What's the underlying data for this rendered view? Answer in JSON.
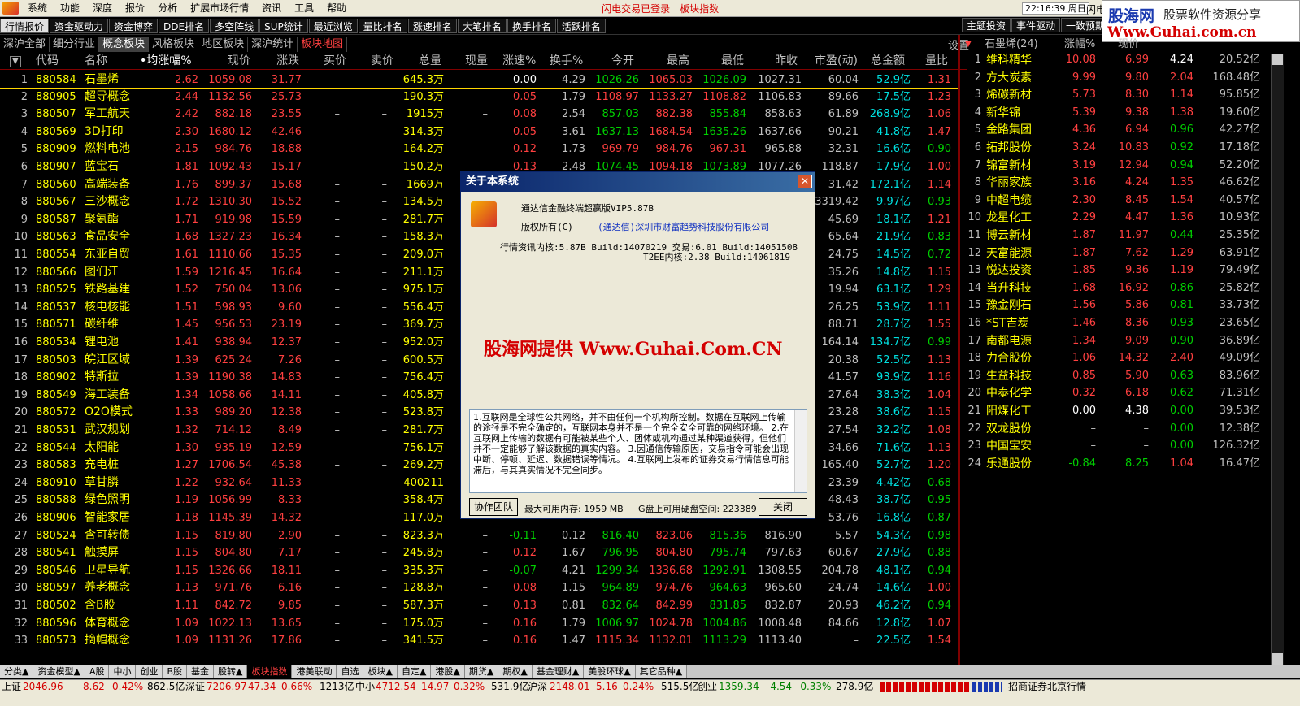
{
  "menubar": {
    "items": [
      "系统",
      "功能",
      "深度",
      "报价",
      "分析",
      "扩展市场行情",
      "资讯",
      "工具",
      "帮助"
    ],
    "alert1": "闪电交易已登录",
    "alert2": "板块指数",
    "time": "22:16:39 周日",
    "flash": "闪电手"
  },
  "banner": {
    "line1": "股海网",
    "line1b": "股票软件资源分享",
    "line2": "Www.Guhai.com.cn"
  },
  "tabs1": [
    "行情报价",
    "资金驱动力",
    "资金博弈",
    "DDE排名",
    "多空阵线",
    "SUP统计",
    "最近浏览",
    "量比排名",
    "涨速排名",
    "大笔排名",
    "换手排名",
    "活跃排名"
  ],
  "tabs1_right": [
    "主题投资",
    "事件驱动",
    "一致预期",
    "板"
  ],
  "tabs2": [
    "深沪全部",
    "细分行业",
    "概念板块",
    "风格板块",
    "地区板块",
    "深沪统计",
    "板块地图"
  ],
  "settings": "设置",
  "main_header": {
    "code": "代码",
    "name": "名称",
    "chg": "•均涨幅%",
    "price": "现价",
    "up": "涨跌",
    "buy": "买价",
    "sell": "卖价",
    "vol": "总量",
    "cur": "现量",
    "spd": "涨速%",
    "turn": "换手%",
    "open": "今开",
    "high": "最高",
    "low": "最低",
    "prev": "昨收",
    "pe": "市盈(动)",
    "amt": "总金额",
    "ratio": "量比"
  },
  "rows": [
    [
      "1",
      "880584",
      "石墨烯",
      "2.62",
      "1059.08",
      "31.77",
      "–",
      "–",
      "645.3万",
      "–",
      "0.00",
      "4.29",
      "1026.26",
      "1065.03",
      "1026.09",
      "1027.31",
      "60.04",
      "52.9亿",
      "1.31"
    ],
    [
      "2",
      "880905",
      "超导概念",
      "2.44",
      "1132.56",
      "25.73",
      "–",
      "–",
      "190.3万",
      "–",
      "0.05",
      "1.79",
      "1108.97",
      "1133.27",
      "1108.82",
      "1106.83",
      "89.66",
      "17.5亿",
      "1.23"
    ],
    [
      "3",
      "880507",
      "军工航天",
      "2.42",
      "882.18",
      "23.55",
      "–",
      "–",
      "1915万",
      "–",
      "0.08",
      "2.54",
      "857.03",
      "882.38",
      "855.84",
      "858.63",
      "61.89",
      "268.9亿",
      "1.06"
    ],
    [
      "4",
      "880569",
      "3D打印",
      "2.30",
      "1680.12",
      "42.46",
      "–",
      "–",
      "314.3万",
      "–",
      "0.05",
      "3.61",
      "1637.13",
      "1684.54",
      "1635.26",
      "1637.66",
      "90.21",
      "41.8亿",
      "1.47"
    ],
    [
      "5",
      "880909",
      "燃料电池",
      "2.15",
      "984.76",
      "18.88",
      "–",
      "–",
      "164.2万",
      "–",
      "0.12",
      "1.73",
      "969.79",
      "984.76",
      "967.31",
      "965.88",
      "32.31",
      "16.6亿",
      "0.90"
    ],
    [
      "6",
      "880907",
      "蓝宝石",
      "1.81",
      "1092.43",
      "15.17",
      "–",
      "–",
      "150.2万",
      "–",
      "0.13",
      "2.48",
      "1074.45",
      "1094.18",
      "1073.89",
      "1077.26",
      "118.87",
      "17.9亿",
      "1.00"
    ],
    [
      "7",
      "880560",
      "高端装备",
      "1.76",
      "899.37",
      "15.68",
      "–",
      "–",
      "1669万",
      "–",
      "",
      "",
      "",
      "",
      "",
      "",
      "31.42",
      "172.1亿",
      "1.14"
    ],
    [
      "8",
      "880567",
      "三沙概念",
      "1.72",
      "1310.30",
      "15.52",
      "–",
      "–",
      "134.5万",
      "–",
      "",
      "",
      "",
      "",
      "",
      "",
      "3319.42",
      "9.97亿",
      "0.93"
    ],
    [
      "9",
      "880587",
      "聚氨酯",
      "1.71",
      "919.98",
      "15.59",
      "–",
      "–",
      "281.7万",
      "–",
      "",
      "",
      "",
      "",
      "",
      "",
      "45.69",
      "18.1亿",
      "1.21"
    ],
    [
      "10",
      "880563",
      "食品安全",
      "1.68",
      "1327.23",
      "16.34",
      "–",
      "–",
      "158.3万",
      "–",
      "",
      "",
      "",
      "",
      "",
      "",
      "65.64",
      "21.9亿",
      "0.83"
    ],
    [
      "11",
      "880554",
      "东亚自贸",
      "1.61",
      "1110.66",
      "15.35",
      "–",
      "–",
      "209.0万",
      "–",
      "",
      "",
      "",
      "",
      "",
      "",
      "24.75",
      "14.5亿",
      "0.72"
    ],
    [
      "12",
      "880566",
      "图们江",
      "1.59",
      "1216.45",
      "16.64",
      "–",
      "–",
      "211.1万",
      "–",
      "",
      "",
      "",
      "",
      "",
      "",
      "35.26",
      "14.8亿",
      "1.15"
    ],
    [
      "13",
      "880525",
      "铁路基建",
      "1.52",
      "750.04",
      "13.06",
      "–",
      "–",
      "975.1万",
      "–",
      "",
      "",
      "",
      "",
      "",
      "",
      "19.94",
      "63.1亿",
      "1.29"
    ],
    [
      "14",
      "880537",
      "核电核能",
      "1.51",
      "598.93",
      "9.60",
      "–",
      "–",
      "556.4万",
      "–",
      "",
      "",
      "",
      "",
      "",
      "",
      "26.25",
      "53.9亿",
      "1.11"
    ],
    [
      "15",
      "880571",
      "碳纤维",
      "1.45",
      "956.53",
      "23.19",
      "–",
      "–",
      "369.7万",
      "–",
      "",
      "",
      "",
      "",
      "",
      "",
      "88.71",
      "28.7亿",
      "1.55"
    ],
    [
      "16",
      "880534",
      "锂电池",
      "1.41",
      "938.94",
      "12.37",
      "–",
      "–",
      "952.0万",
      "–",
      "",
      "",
      "",
      "",
      "",
      "",
      "164.14",
      "134.7亿",
      "0.99"
    ],
    [
      "17",
      "880503",
      "皖江区域",
      "1.39",
      "625.24",
      "7.26",
      "–",
      "–",
      "600.5万",
      "–",
      "",
      "",
      "",
      "",
      "",
      "",
      "20.38",
      "52.5亿",
      "1.13"
    ],
    [
      "18",
      "880902",
      "特斯拉",
      "1.39",
      "1190.38",
      "14.83",
      "–",
      "–",
      "756.4万",
      "–",
      "",
      "",
      "",
      "",
      "",
      "",
      "41.57",
      "93.9亿",
      "1.16"
    ],
    [
      "19",
      "880549",
      "海工装备",
      "1.34",
      "1058.66",
      "14.11",
      "–",
      "–",
      "405.8万",
      "–",
      "",
      "",
      "",
      "",
      "",
      "",
      "27.64",
      "38.3亿",
      "1.04"
    ],
    [
      "20",
      "880572",
      "O2O模式",
      "1.33",
      "989.20",
      "12.38",
      "–",
      "–",
      "523.8万",
      "–",
      "",
      "",
      "",
      "",
      "",
      "",
      "23.28",
      "38.6亿",
      "1.15"
    ],
    [
      "21",
      "880531",
      "武汉规划",
      "1.32",
      "714.12",
      "8.49",
      "–",
      "–",
      "281.7万",
      "–",
      "",
      "",
      "",
      "",
      "",
      "",
      "27.54",
      "32.2亿",
      "1.08"
    ],
    [
      "22",
      "880544",
      "太阳能",
      "1.30",
      "935.19",
      "12.59",
      "–",
      "–",
      "756.1万",
      "–",
      "",
      "",
      "",
      "",
      "",
      "",
      "34.66",
      "71.6亿",
      "1.13"
    ],
    [
      "23",
      "880583",
      "充电桩",
      "1.27",
      "1706.54",
      "45.38",
      "–",
      "–",
      "269.2万",
      "–",
      "",
      "",
      "",
      "",
      "",
      "",
      "165.40",
      "52.7亿",
      "1.20"
    ],
    [
      "24",
      "880910",
      "草甘膦",
      "1.22",
      "932.64",
      "11.33",
      "–",
      "–",
      "400211",
      "–",
      "",
      "",
      "",
      "",
      "",
      "",
      "23.39",
      "4.42亿",
      "0.68"
    ],
    [
      "25",
      "880588",
      "绿色照明",
      "1.19",
      "1056.99",
      "8.33",
      "–",
      "–",
      "358.4万",
      "–",
      "",
      "",
      "",
      "",
      "",
      "",
      "48.43",
      "38.7亿",
      "0.95"
    ],
    [
      "26",
      "880906",
      "智能家居",
      "1.18",
      "1145.39",
      "14.32",
      "–",
      "–",
      "117.0万",
      "–",
      "",
      "",
      "",
      "",
      "",
      "",
      "53.76",
      "16.8亿",
      "0.87"
    ],
    [
      "27",
      "880524",
      "含可转债",
      "1.15",
      "819.80",
      "2.90",
      "–",
      "–",
      "823.3万",
      "–",
      "-0.11",
      "0.12",
      "816.40",
      "823.06",
      "815.36",
      "816.90",
      "5.57",
      "54.3亿",
      "0.98"
    ],
    [
      "28",
      "880541",
      "触摸屏",
      "1.15",
      "804.80",
      "7.17",
      "–",
      "–",
      "245.8万",
      "–",
      "0.12",
      "1.67",
      "796.95",
      "804.80",
      "795.74",
      "797.63",
      "60.67",
      "27.9亿",
      "0.88"
    ],
    [
      "29",
      "880546",
      "卫星导航",
      "1.15",
      "1326.66",
      "18.11",
      "–",
      "–",
      "335.3万",
      "–",
      "-0.07",
      "4.21",
      "1299.34",
      "1336.68",
      "1292.91",
      "1308.55",
      "204.78",
      "48.1亿",
      "0.94"
    ],
    [
      "30",
      "880597",
      "养老概念",
      "1.13",
      "971.76",
      "6.16",
      "–",
      "–",
      "128.8万",
      "–",
      "0.08",
      "1.15",
      "964.89",
      "974.76",
      "964.63",
      "965.60",
      "24.74",
      "14.6亿",
      "1.00"
    ],
    [
      "31",
      "880502",
      "含B股",
      "1.11",
      "842.72",
      "9.85",
      "–",
      "–",
      "587.3万",
      "–",
      "0.13",
      "0.81",
      "832.64",
      "842.99",
      "831.85",
      "832.87",
      "20.93",
      "46.2亿",
      "0.94"
    ],
    [
      "32",
      "880596",
      "体育概念",
      "1.09",
      "1022.13",
      "13.65",
      "–",
      "–",
      "175.0万",
      "–",
      "0.16",
      "1.79",
      "1006.97",
      "1024.78",
      "1004.86",
      "1008.48",
      "84.66",
      "12.8亿",
      "1.07"
    ],
    [
      "33",
      "880573",
      "摘帽概念",
      "1.09",
      "1131.26",
      "17.86",
      "–",
      "–",
      "341.5万",
      "–",
      "0.16",
      "1.47",
      "1115.34",
      "1132.01",
      "1113.29",
      "1113.40",
      "–",
      "22.5亿",
      "1.54"
    ]
  ],
  "right_header": {
    "mark": "▼",
    "block": "石墨烯(24)",
    "chg": "涨幅%",
    "price": "现价"
  },
  "right_rows": [
    [
      "1",
      "维科精华",
      "10.08",
      "6.99",
      "4.24",
      "20.52亿"
    ],
    [
      "2",
      "方大炭素",
      "9.99",
      "9.80",
      "2.04",
      "168.48亿"
    ],
    [
      "3",
      "烯碳新材",
      "5.73",
      "8.30",
      "1.14",
      "95.85亿"
    ],
    [
      "4",
      "新华锦",
      "5.39",
      "9.38",
      "1.38",
      "19.60亿"
    ],
    [
      "5",
      "金路集团",
      "4.36",
      "6.94",
      "0.96",
      "42.27亿"
    ],
    [
      "6",
      "拓邦股份",
      "3.24",
      "10.83",
      "0.92",
      "17.18亿"
    ],
    [
      "7",
      "锦富新材",
      "3.19",
      "12.94",
      "0.94",
      "52.20亿"
    ],
    [
      "8",
      "华丽家族",
      "3.16",
      "4.24",
      "1.35",
      "46.62亿"
    ],
    [
      "9",
      "中超电缆",
      "2.30",
      "8.45",
      "1.54",
      "40.57亿"
    ],
    [
      "10",
      "龙星化工",
      "2.29",
      "4.47",
      "1.36",
      "10.93亿"
    ],
    [
      "11",
      "博云新材",
      "1.87",
      "11.97",
      "0.44",
      "25.35亿"
    ],
    [
      "12",
      "天富能源",
      "1.87",
      "7.62",
      "1.29",
      "63.91亿"
    ],
    [
      "13",
      "悦达投资",
      "1.85",
      "9.36",
      "1.19",
      "79.49亿"
    ],
    [
      "14",
      "当升科技",
      "1.68",
      "16.92",
      "0.86",
      "25.82亿"
    ],
    [
      "15",
      "豫金刚石",
      "1.56",
      "5.86",
      "0.81",
      "33.73亿"
    ],
    [
      "16",
      "*ST吉炭",
      "1.46",
      "8.36",
      "0.93",
      "23.65亿"
    ],
    [
      "17",
      "南都电源",
      "1.34",
      "9.09",
      "0.90",
      "36.89亿"
    ],
    [
      "18",
      "力合股份",
      "1.06",
      "14.32",
      "2.40",
      "49.09亿"
    ],
    [
      "19",
      "生益科技",
      "0.85",
      "5.90",
      "0.63",
      "83.96亿"
    ],
    [
      "20",
      "中泰化学",
      "0.32",
      "6.18",
      "0.62",
      "71.31亿"
    ],
    [
      "21",
      "阳煤化工",
      "0.00",
      "4.38",
      "0.00",
      "39.53亿"
    ],
    [
      "22",
      "双龙股份",
      "–",
      "–",
      "0.00",
      "12.38亿"
    ],
    [
      "23",
      "中国宝安",
      "–",
      "–",
      "0.00",
      "126.32亿"
    ],
    [
      "24",
      "乐通股份",
      "-0.84",
      "8.25",
      "1.04",
      "16.47亿"
    ]
  ],
  "bottom_tabs": [
    "分类▲",
    "资金模型▲",
    "A股",
    "中小",
    "创业",
    "B股",
    "基金",
    "股转▲",
    "板块指数",
    "港美联动",
    "自选",
    "板块▲",
    "自定▲",
    "港股▲",
    "期货▲",
    "期权▲",
    "基金理财▲",
    "美股环球▲",
    "其它品种▲"
  ],
  "status": {
    "sh_label": "上证",
    "sh_val": "2046.96",
    "sh_up": "8.62",
    "sh_pct": "0.42%",
    "sh_amt": "862.5亿",
    "sz_label": "深证",
    "sz_val": "7206.97",
    "sz_up": "47.34",
    "sz_pct": "0.66%",
    "sz_amt": "1213亿",
    "zx_label": "中小",
    "zx_val": "4712.54",
    "zx_up": "14.97",
    "zx_pct": "0.32%",
    "zx_amt": "531.9亿",
    "hs_label": "沪深",
    "hs_val": "2148.01",
    "hs_up": "5.16",
    "hs_pct": "0.24%",
    "hs_amt": "515.5亿",
    "cy_label": "创业",
    "cy_val": "1359.34",
    "cy_up": "-4.54",
    "cy_pct": "-0.33%",
    "cy_amt": "278.9亿",
    "broker": "招商证券北京行情"
  },
  "dialog": {
    "title": "关于本系统",
    "close": "✕",
    "product": "通达信金融终端超赢版VIP5.87B",
    "copyright": "版权所有(C)",
    "company": "(通达信)深圳市财富趋势科技股份有限公司",
    "core1": "行情资讯内核:5.87B Build:14070219 交易:6.01 Build:14051508",
    "core2": "T2EE内核:2.38 Build:14061819",
    "watermark": "股海网提供 Www.Guhai.Com.CN",
    "notice": "1.互联网是全球性公共网络，并不由任何一个机构所控制。数据在互联网上传输的途径是不完全确定的，互联网本身并不是一个完全安全可靠的网络环境。 2.在互联网上传输的数据有可能被某些个人、团体或机构通过某种渠道获得，但他们并不一定能够了解该数据的真实内容。 3.因通信传输原因，交易指令可能会出现中断、停顿、延迟、数据错误等情况。 4.互联网上发布的证券交易行情信息可能滞后，与其真实情况不完全同步。",
    "team_btn": "协作团队",
    "mem": "最大可用内存: 1959 MB",
    "disk": "G盘上可用硬盘空间: 223389",
    "close_btn": "关闭"
  }
}
